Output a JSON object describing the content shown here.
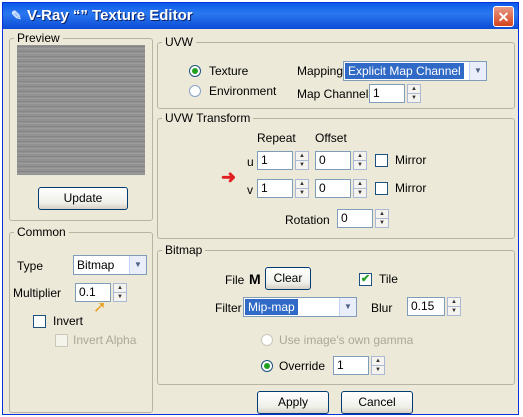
{
  "window": {
    "title": "V-Ray “” Texture Editor",
    "close_label": "✕"
  },
  "preview": {
    "legend": "Preview",
    "update_label": "Update"
  },
  "uvw": {
    "legend": "UVW",
    "texture_label": "Texture",
    "environment_label": "Environment",
    "mapping_label": "Mapping",
    "mapping_value": "Explicit Map Channel",
    "map_channel_label": "Map Channel",
    "map_channel_value": "1"
  },
  "transform": {
    "legend": "UVW Transform",
    "repeat_label": "Repeat",
    "offset_label": "Offset",
    "u_label": "u",
    "v_label": "v",
    "u_repeat": "1",
    "u_offset": "0",
    "v_repeat": "1",
    "v_offset": "0",
    "mirror_label": "Mirror",
    "rotation_label": "Rotation",
    "rotation_value": "0"
  },
  "common": {
    "legend": "Common",
    "type_label": "Type",
    "type_value": "Bitmap",
    "multiplier_label": "Multiplier",
    "multiplier_value": "0.1",
    "invert_label": "Invert",
    "invert_alpha_label": "Invert Alpha"
  },
  "bitmap": {
    "legend": "Bitmap",
    "file_label": "File",
    "file_m": "M",
    "clear_label": "Clear",
    "tile_label": "Tile",
    "tile_checked": true,
    "filter_label": "Filter",
    "filter_value": "Mip-map",
    "blur_label": "Blur",
    "blur_value": "0.15",
    "use_gamma_label": "Use image's own gamma",
    "override_label": "Override",
    "override_value": "1"
  },
  "footer": {
    "apply_label": "Apply",
    "cancel_label": "Cancel"
  },
  "colors": {
    "title_bar": "#0a5ae8",
    "dialog_bg": "#ece9d8",
    "accent_arrow": "#e02020",
    "selection": "#3169c6"
  }
}
